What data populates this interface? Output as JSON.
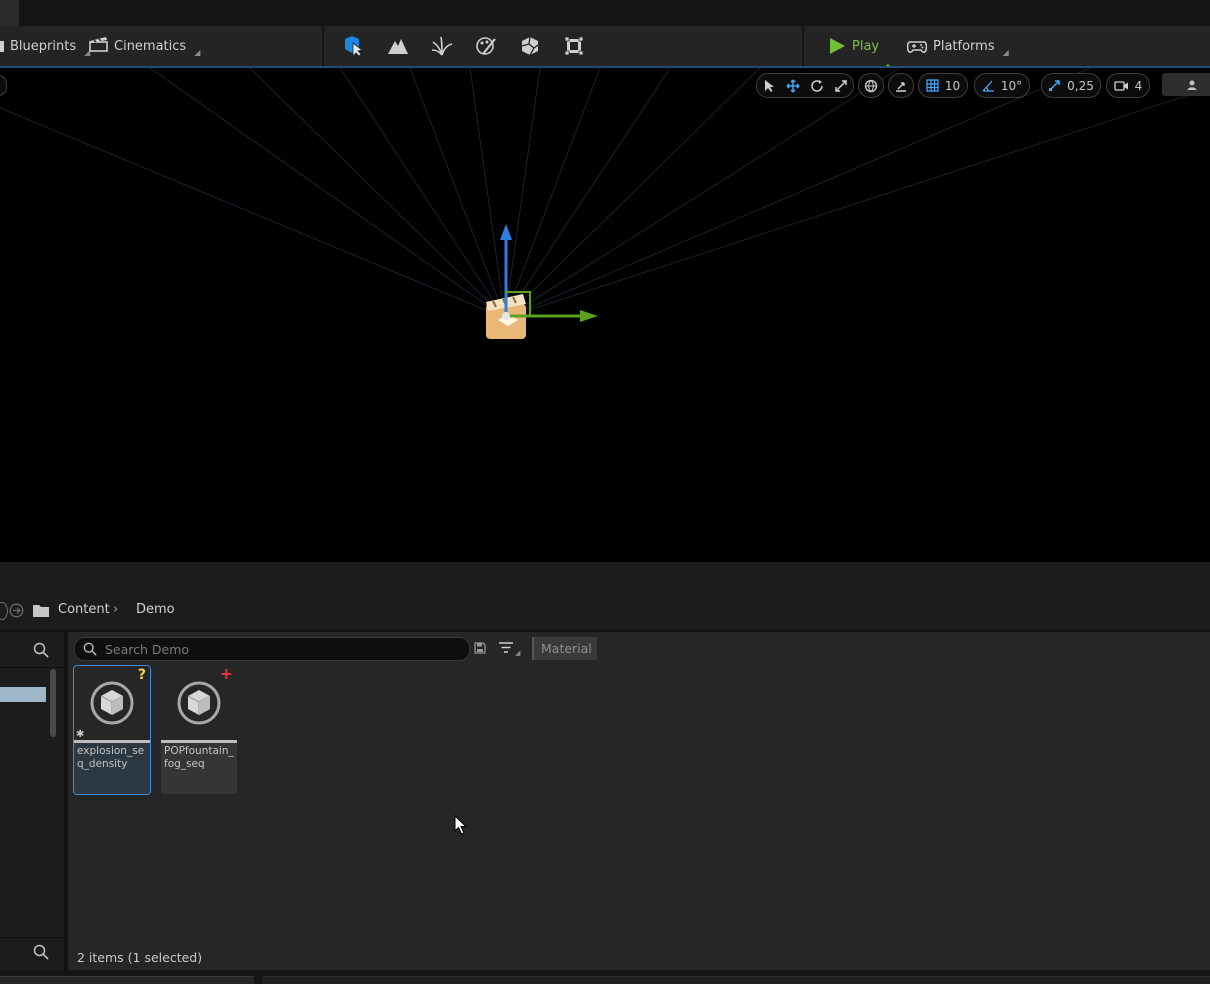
{
  "toolbar": {
    "blueprints_label": "Blueprints",
    "cinematics_label": "Cinematics",
    "play_label": "Play",
    "platforms_label": "Platforms"
  },
  "viewport": {
    "grid_snap": "10",
    "rotation_snap": "10°",
    "scale_snap": "0,25",
    "camera_speed": "4"
  },
  "content_browser": {
    "breadcrumb": [
      "Content",
      "Demo"
    ],
    "search_placeholder": "Search Demo",
    "filter_chip": "Material",
    "assets": [
      {
        "name": "explosion_seq_density",
        "badge": "?",
        "selected": true
      },
      {
        "name": "POPfountain_fog_seq",
        "badge": "+",
        "selected": false
      }
    ],
    "status": "2 items (1 selected)"
  },
  "colors": {
    "accent_blue": "#1e88e5",
    "play_green": "#6fbf3a",
    "gizmo_blue": "#2f7fe0",
    "gizmo_green": "#5aa11e"
  }
}
